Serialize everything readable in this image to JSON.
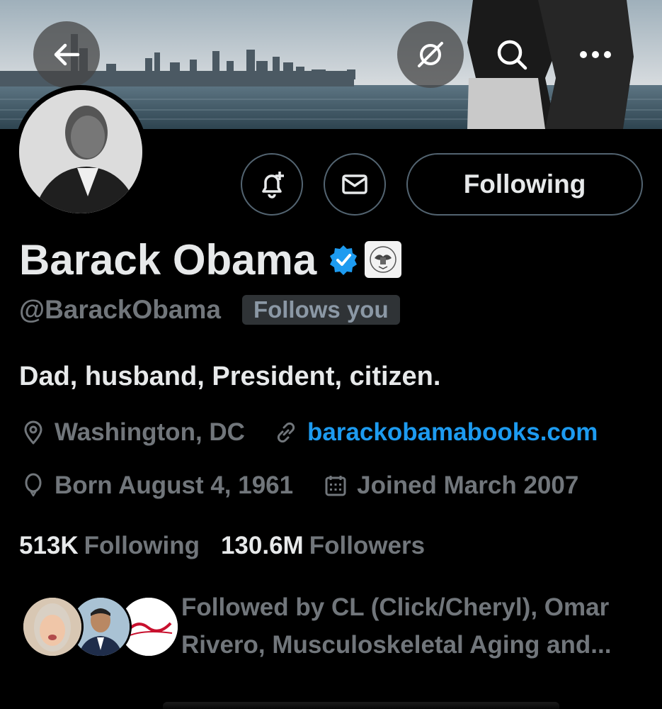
{
  "header": {
    "back_icon": "arrow-left-icon",
    "grok_icon": "grok-icon",
    "search_icon": "search-icon",
    "more_icon": "more-horizontal-icon"
  },
  "actions": {
    "notify_icon": "bell-plus-icon",
    "message_icon": "envelope-icon",
    "following_label": "Following"
  },
  "profile": {
    "name": "Barack Obama",
    "verified_icon": "verified-badge-icon",
    "affiliation_icon": "us-seal-icon",
    "handle": "@BarackObama",
    "follows_you": "Follows you",
    "bio": "Dad, husband, President, citizen.",
    "location": "Washington, DC",
    "website": "barackobamabooks.com",
    "born": "Born August 4, 1961",
    "joined": "Joined March 2007"
  },
  "stats": {
    "following_count": "513K",
    "following_label": "Following",
    "followers_count": "130.6M",
    "followers_label": "Followers"
  },
  "followed_by": {
    "text": "Followed by CL (Click/Cheryl), Omar Rivero, Musculoskeletal Aging and..."
  },
  "colors": {
    "background": "#000000",
    "text_primary": "#e7e9ea",
    "text_secondary": "#71767b",
    "link": "#1d9bf0",
    "verified": "#1d9bf0",
    "border": "#536471"
  }
}
